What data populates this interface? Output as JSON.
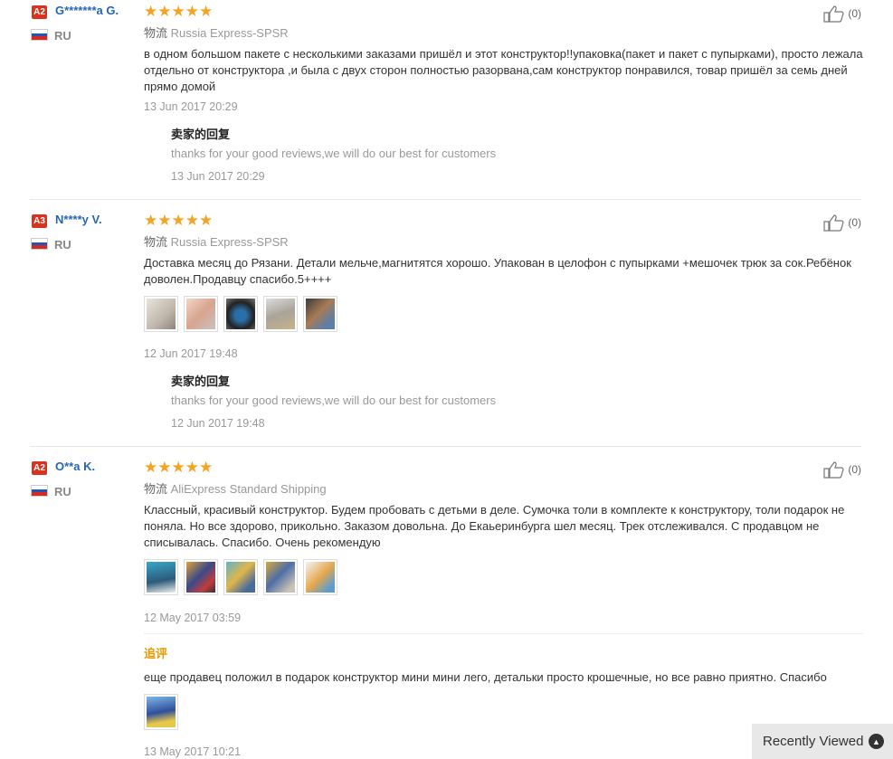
{
  "logistics_label": "物流",
  "reply_label": "卖家的回复",
  "followup_label": "追评",
  "reviews": [
    {
      "badge": "A2",
      "user": "G*******a G.",
      "country": "RU",
      "stars": "★★★★★",
      "logistics": "Russia Express-SPSR",
      "likes": "(0)",
      "text": "в одном большом пакете с несколькими заказами пришёл и этот конструктор!!упаковка(пакет и пакет с пупырками), просто лежала отдельно от конструктора ,и была с двух сторон полностью разорвана,сам конструктор понравился, товар пришёл за семь дней прямо домой",
      "date": "13 Jun 2017 20:29",
      "reply_text": "thanks for your good reviews,we will do our best for customers",
      "reply_date": "13 Jun 2017 20:29"
    },
    {
      "badge": "A3",
      "user": "N****y V.",
      "country": "RU",
      "stars": "★★★★★",
      "logistics": "Russia Express-SPSR",
      "likes": "(0)",
      "text": "Доставка месяц до Рязани. Детали мельче,магнитятся хорошо. Упакован в целофон с пупырками +мешочек трюк за сок.Ребёнок доволен.Продавцу спасибо.5++++",
      "date": "12 Jun 2017 19:48",
      "reply_text": "thanks for your good reviews,we will do our best for customers",
      "reply_date": "12 Jun 2017 19:48"
    },
    {
      "badge": "A2",
      "user": "O**a K.",
      "country": "RU",
      "stars": "★★★★★",
      "logistics": "AliExpress Standard Shipping",
      "likes": "(0)",
      "text": "Классный, красивый конструктор. Будем пробовать с детьми в деле. Сумочка толи в комплекте к конструктору, толи подарок не поняла. Но все здорово, прикольно. Заказом довольна. До Екаьеринбурга шел месяц. Трек отслеживался. С продавцом не списывалась. Спасибо. Очень рекомендую",
      "date": "12 May 2017 03:59",
      "followup_text": "еще продавец положил в подарок конструктор мини мини лего, детальки просто крошечные, но все равно приятно. Спасибо",
      "followup_date": "13 May 2017 10:21"
    }
  ],
  "recently_viewed": "Recently Viewed"
}
